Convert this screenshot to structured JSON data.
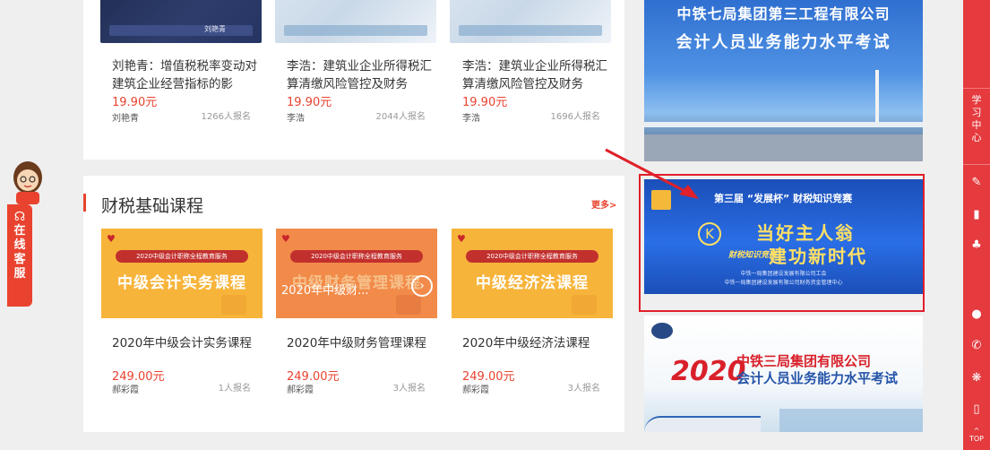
{
  "top_courses": [
    {
      "thumb_text": "刘艳青",
      "title": "刘艳青：增值税税率变动对建筑企业经营指标的影",
      "price": "19.90元",
      "author": "刘艳青",
      "signup": "1266人报名"
    },
    {
      "thumb_text": "",
      "title": "李浩：建筑业企业所得税汇算清缴风险管控及财务",
      "price": "19.90元",
      "author": "李浩",
      "signup": "2044人报名"
    },
    {
      "thumb_text": "",
      "title": "李浩：建筑业企业所得税汇算清缴风险管控及财务",
      "price": "19.90元",
      "author": "李浩",
      "signup": "1696人报名"
    }
  ],
  "section": {
    "title": "财税基础课程",
    "more": "更多>"
  },
  "basic_courses": [
    {
      "logo": "♥",
      "banner": "2020中级会计职称全程教育服务",
      "tile_name": "中级会计实务课程",
      "overlay": "",
      "title": "2020年中级会计实务课程",
      "price": "249.00元",
      "author": "郝彩霞",
      "signup": "1人报名"
    },
    {
      "logo": "♥",
      "banner": "2020中级会计职称全程教育服务",
      "tile_name": "中级财务管理课程",
      "overlay": "2020年中级财...",
      "title": "2020年中级财务管理课程",
      "price": "249.00元",
      "author": "郝彩霞",
      "signup": "3人报名"
    },
    {
      "logo": "♥",
      "banner": "2020中级会计职称全程教育服务",
      "tile_name": "中级经济法课程",
      "overlay": "",
      "title": "2020年中级经济法课程",
      "price": "249.00元",
      "author": "郝彩霞",
      "signup": "3人报名"
    }
  ],
  "banners": {
    "b1_line1": "中铁七局集团第三工程有限公司",
    "b1_line2": "会计人员业务能力水平考试",
    "b2_head": "第三届 “发展杯” 财税知识竞赛",
    "b2_big1": "当好主人翁",
    "b2_big2": "建功新时代",
    "b2_tag": "财税知识竞赛",
    "b2_k": "K",
    "b2_small1": "中铁一局集团建设发展有限公司工会",
    "b2_small2": "中铁一局集团建设发展有限公司财务资金管理中心",
    "b3_year": "2020",
    "b3_line1": "中铁三局集团有限公司",
    "b3_line2": "会计人员业务能力水平考试"
  },
  "left_widget": {
    "chars": [
      "在",
      "线",
      "客",
      "服"
    ],
    "headset_icon": "headset-icon"
  },
  "right_toolbar": {
    "study": [
      "学",
      "习",
      "中",
      "心"
    ],
    "top": "TOP",
    "icons": [
      "edit-icon",
      "book-icon",
      "bell-icon",
      "user-icon",
      "phone-icon",
      "wechat-icon",
      "mobile-icon"
    ]
  },
  "colors": {
    "accent": "#e9432f",
    "toolbar": "#e53a3e",
    "highlight": "#e0202a",
    "tile_yellow": "#f7b43a",
    "tile_orange": "#f28b4a"
  }
}
